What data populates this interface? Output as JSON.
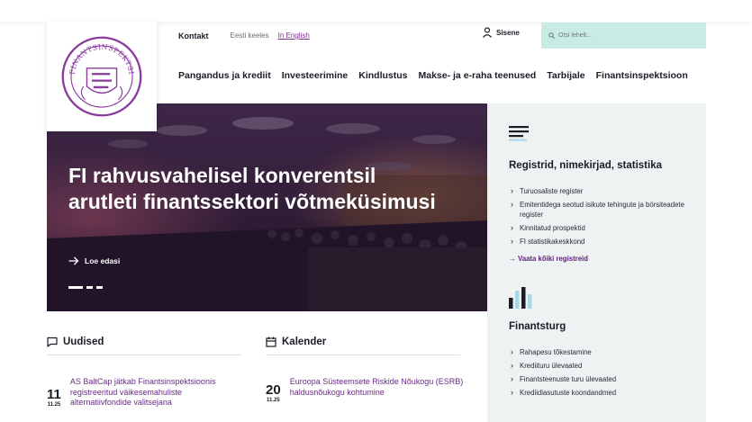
{
  "utility": {
    "contact": "Kontakt",
    "lang_et": "Eesti keeles",
    "lang_en": "In English",
    "signin": "Sisene",
    "search_placeholder": "Otsi lehelt..."
  },
  "nav": [
    "Pangandus ja krediit",
    "Investeerimine",
    "Kindlustus",
    "Makse- ja e-raha teenused",
    "Tarbijale",
    "Finantsinspektsioon"
  ],
  "hero": {
    "title": "FI rahvusvahelisel konverentsil arutleti finantssektori võtmeküsimusi",
    "link": "Loe edasi"
  },
  "registers": {
    "heading": "Registrid, nimekirjad, statistika",
    "items": [
      "Turuosaliste register",
      "Emitentidega seotud isikute tehingute ja börsiteadete register",
      "Kinnitatud prospektid",
      "FI statistikakeskkond"
    ],
    "all_link": "→ Vaata kõiki registreid"
  },
  "market": {
    "heading": "Finantsturg",
    "items": [
      "Rahapesu tõkestamine",
      "Krediituru ülevaated",
      "Finantsteenuste turu ülevaated",
      "Krediidiasutuste koondandmed"
    ]
  },
  "news": {
    "heading": "Uudised",
    "item": {
      "day": "11",
      "month": "11.25",
      "text": "AS BaltCap jätkab Finantsinspektsioonis registreeritud väikesemahuliste alternatiivfondide valitsejana"
    }
  },
  "calendar": {
    "heading": "Kalender",
    "item": {
      "day": "20",
      "month": "11.25",
      "text": "Euroopa Süsteemsete Riskide Nõukogu (ESRB) haldusnõukogu kohtumine"
    }
  },
  "colors": {
    "accent": "#7a2d8c",
    "search_bg": "#c9ebe6",
    "panel_bg": "#eef2f3"
  },
  "icons": [
    "logo-seal",
    "user-icon",
    "search-icon",
    "arrow-right-icon",
    "menu-lines-icon",
    "bar-chart-icon",
    "chat-icon",
    "calendar-icon"
  ]
}
